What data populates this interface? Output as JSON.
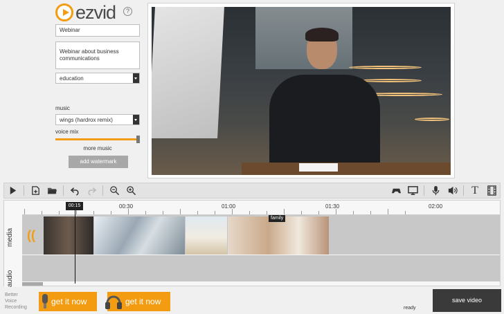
{
  "app": {
    "logo_text": "ezvid",
    "help_symbol": "?"
  },
  "form": {
    "title_value": "Webinar",
    "description_value": "Webinar about business communications",
    "category_value": "education",
    "music_label": "music",
    "music_value": "wings (hardrox remix)",
    "voice_mix_label": "voice mix",
    "voice_mix_level": 1.0,
    "more_music_label": "more music",
    "watermark_label": "add watermark"
  },
  "toolbar": {
    "left_icons": [
      "play-icon",
      "add-media-icon",
      "open-folder-icon",
      "undo-icon",
      "redo-icon",
      "zoom-out-icon",
      "zoom-in-icon"
    ],
    "right_icons": [
      "gamepad-icon",
      "screen-capture-icon",
      "microphone-icon",
      "speech-icon",
      "text-icon",
      "film-icon"
    ],
    "text_glyph": "T"
  },
  "timeline": {
    "playhead_label": "00:15",
    "ticks": [
      "00:30",
      "01:00",
      "01:30",
      "02:00"
    ],
    "media_label": "media",
    "audio_label": "audio",
    "clip_label": "family"
  },
  "bottom": {
    "better_voice": [
      "Better",
      "Voice",
      "Recording"
    ],
    "promo_1_label": "get it now",
    "promo_2_label": "get it now",
    "status": "ready",
    "save_label": "save video"
  },
  "colors": {
    "accent": "#f39c12",
    "save_button": "#3a3a3a",
    "track": "#c8c8c8"
  }
}
